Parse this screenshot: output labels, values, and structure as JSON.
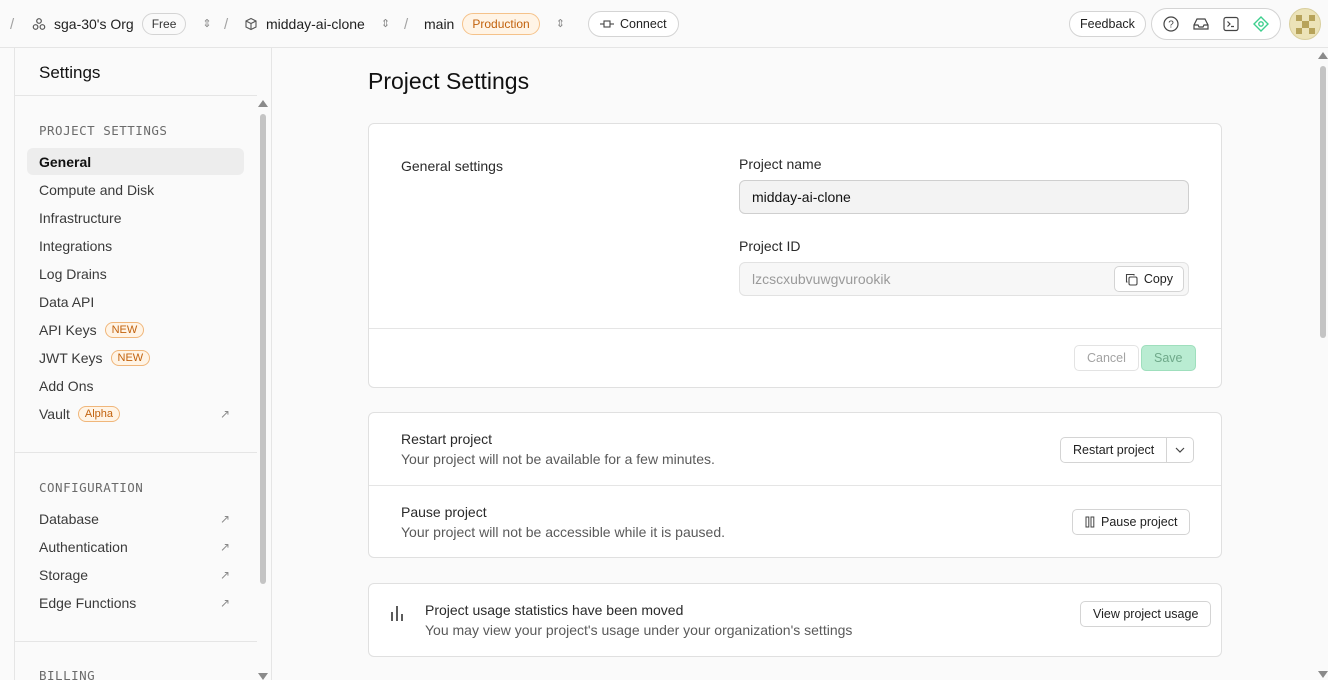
{
  "topbar": {
    "slash": "/",
    "org_name": "sga-30's Org",
    "plan_badge": "Free",
    "project_name": "midday-ai-clone",
    "branch": "main",
    "env_badge": "Production",
    "connect_label": "Connect",
    "feedback_label": "Feedback"
  },
  "sidebar": {
    "title": "Settings",
    "project_settings_heading": "PROJECT SETTINGS",
    "project_items": [
      {
        "label": "General"
      },
      {
        "label": "Compute and Disk"
      },
      {
        "label": "Infrastructure"
      },
      {
        "label": "Integrations"
      },
      {
        "label": "Log Drains"
      },
      {
        "label": "Data API"
      },
      {
        "label": "API Keys",
        "tag": "NEW"
      },
      {
        "label": "JWT Keys",
        "tag": "NEW"
      },
      {
        "label": "Add Ons"
      },
      {
        "label": "Vault",
        "tag": "Alpha"
      }
    ],
    "configuration_heading": "CONFIGURATION",
    "configuration_items": [
      {
        "label": "Database"
      },
      {
        "label": "Authentication"
      },
      {
        "label": "Storage"
      },
      {
        "label": "Edge Functions"
      }
    ],
    "billing_heading": "BILLING",
    "external_glyph": "↗"
  },
  "main": {
    "page_title": "Project Settings",
    "general": {
      "section_label": "General settings",
      "project_name_label": "Project name",
      "project_name_value": "midday-ai-clone",
      "project_id_label": "Project ID",
      "project_id_value": "lzcscxubvuwgvurookik",
      "copy_label": "Copy",
      "cancel_label": "Cancel",
      "save_label": "Save"
    },
    "restart": {
      "title": "Restart project",
      "desc": "Your project will not be available for a few minutes.",
      "button_label": "Restart project"
    },
    "pause": {
      "title": "Pause project",
      "desc": "Your project will not be accessible while it is paused.",
      "button_label": "Pause project"
    },
    "usage": {
      "title": "Project usage statistics have been moved",
      "desc": "You may view your project's usage under your organization's settings",
      "button_label": "View project usage"
    }
  },
  "colors": {
    "accent_orange": "#c2620d",
    "save_green": "#b9ecd2",
    "brand_green": "#3ecf8e"
  }
}
